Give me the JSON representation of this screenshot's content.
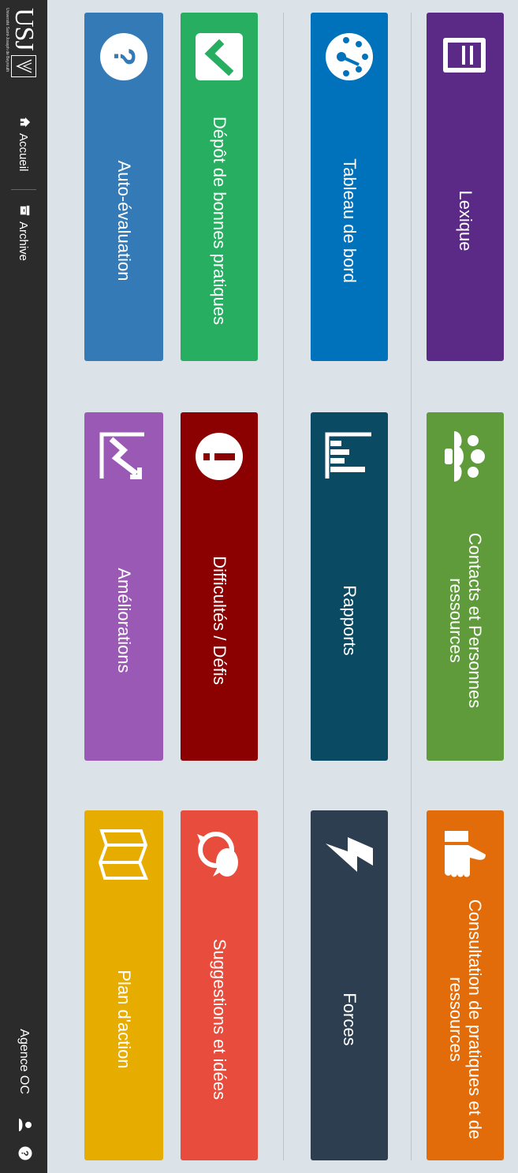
{
  "nav": {
    "logo_text": "USJ",
    "logo_sub": "Université Saint-Joseph de Beyrouth",
    "accueil": "Accueil",
    "archive": "Archive",
    "agence": "Agence OC"
  },
  "tiles": {
    "auto_evaluation": {
      "label": "Auto-évaluation",
      "color": "#337ab7"
    },
    "ameliorations": {
      "label": "Améliorations",
      "color": "#9b59b6"
    },
    "plan_action": {
      "label": "Plan d'action",
      "color": "#e6ad00"
    },
    "depot": {
      "label": "Dépôt de bonnes pratiques",
      "color": "#27ae60"
    },
    "difficultes": {
      "label": "Difficultés / Défis",
      "color": "#8b0000"
    },
    "suggestions": {
      "label": "Suggestions et idées",
      "color": "#e74c3c"
    },
    "tableau": {
      "label": "Tableau de bord",
      "color": "#0072bc"
    },
    "rapports": {
      "label": "Rapports",
      "color": "#0a4a63"
    },
    "forces": {
      "label": "Forces",
      "color": "#2c3e50"
    },
    "lexique": {
      "label": "Lexique",
      "color": "#5b2a86"
    },
    "contacts": {
      "label": "Contacts et Personnes ressources",
      "color": "#5f9b3b"
    },
    "consultation": {
      "label": "Consultation de pratiques et de ressources",
      "color": "#e36c0a"
    }
  },
  "icons": {
    "help": "help-icon",
    "user": "user-icon",
    "home": "home-icon",
    "archive": "archive-icon"
  }
}
